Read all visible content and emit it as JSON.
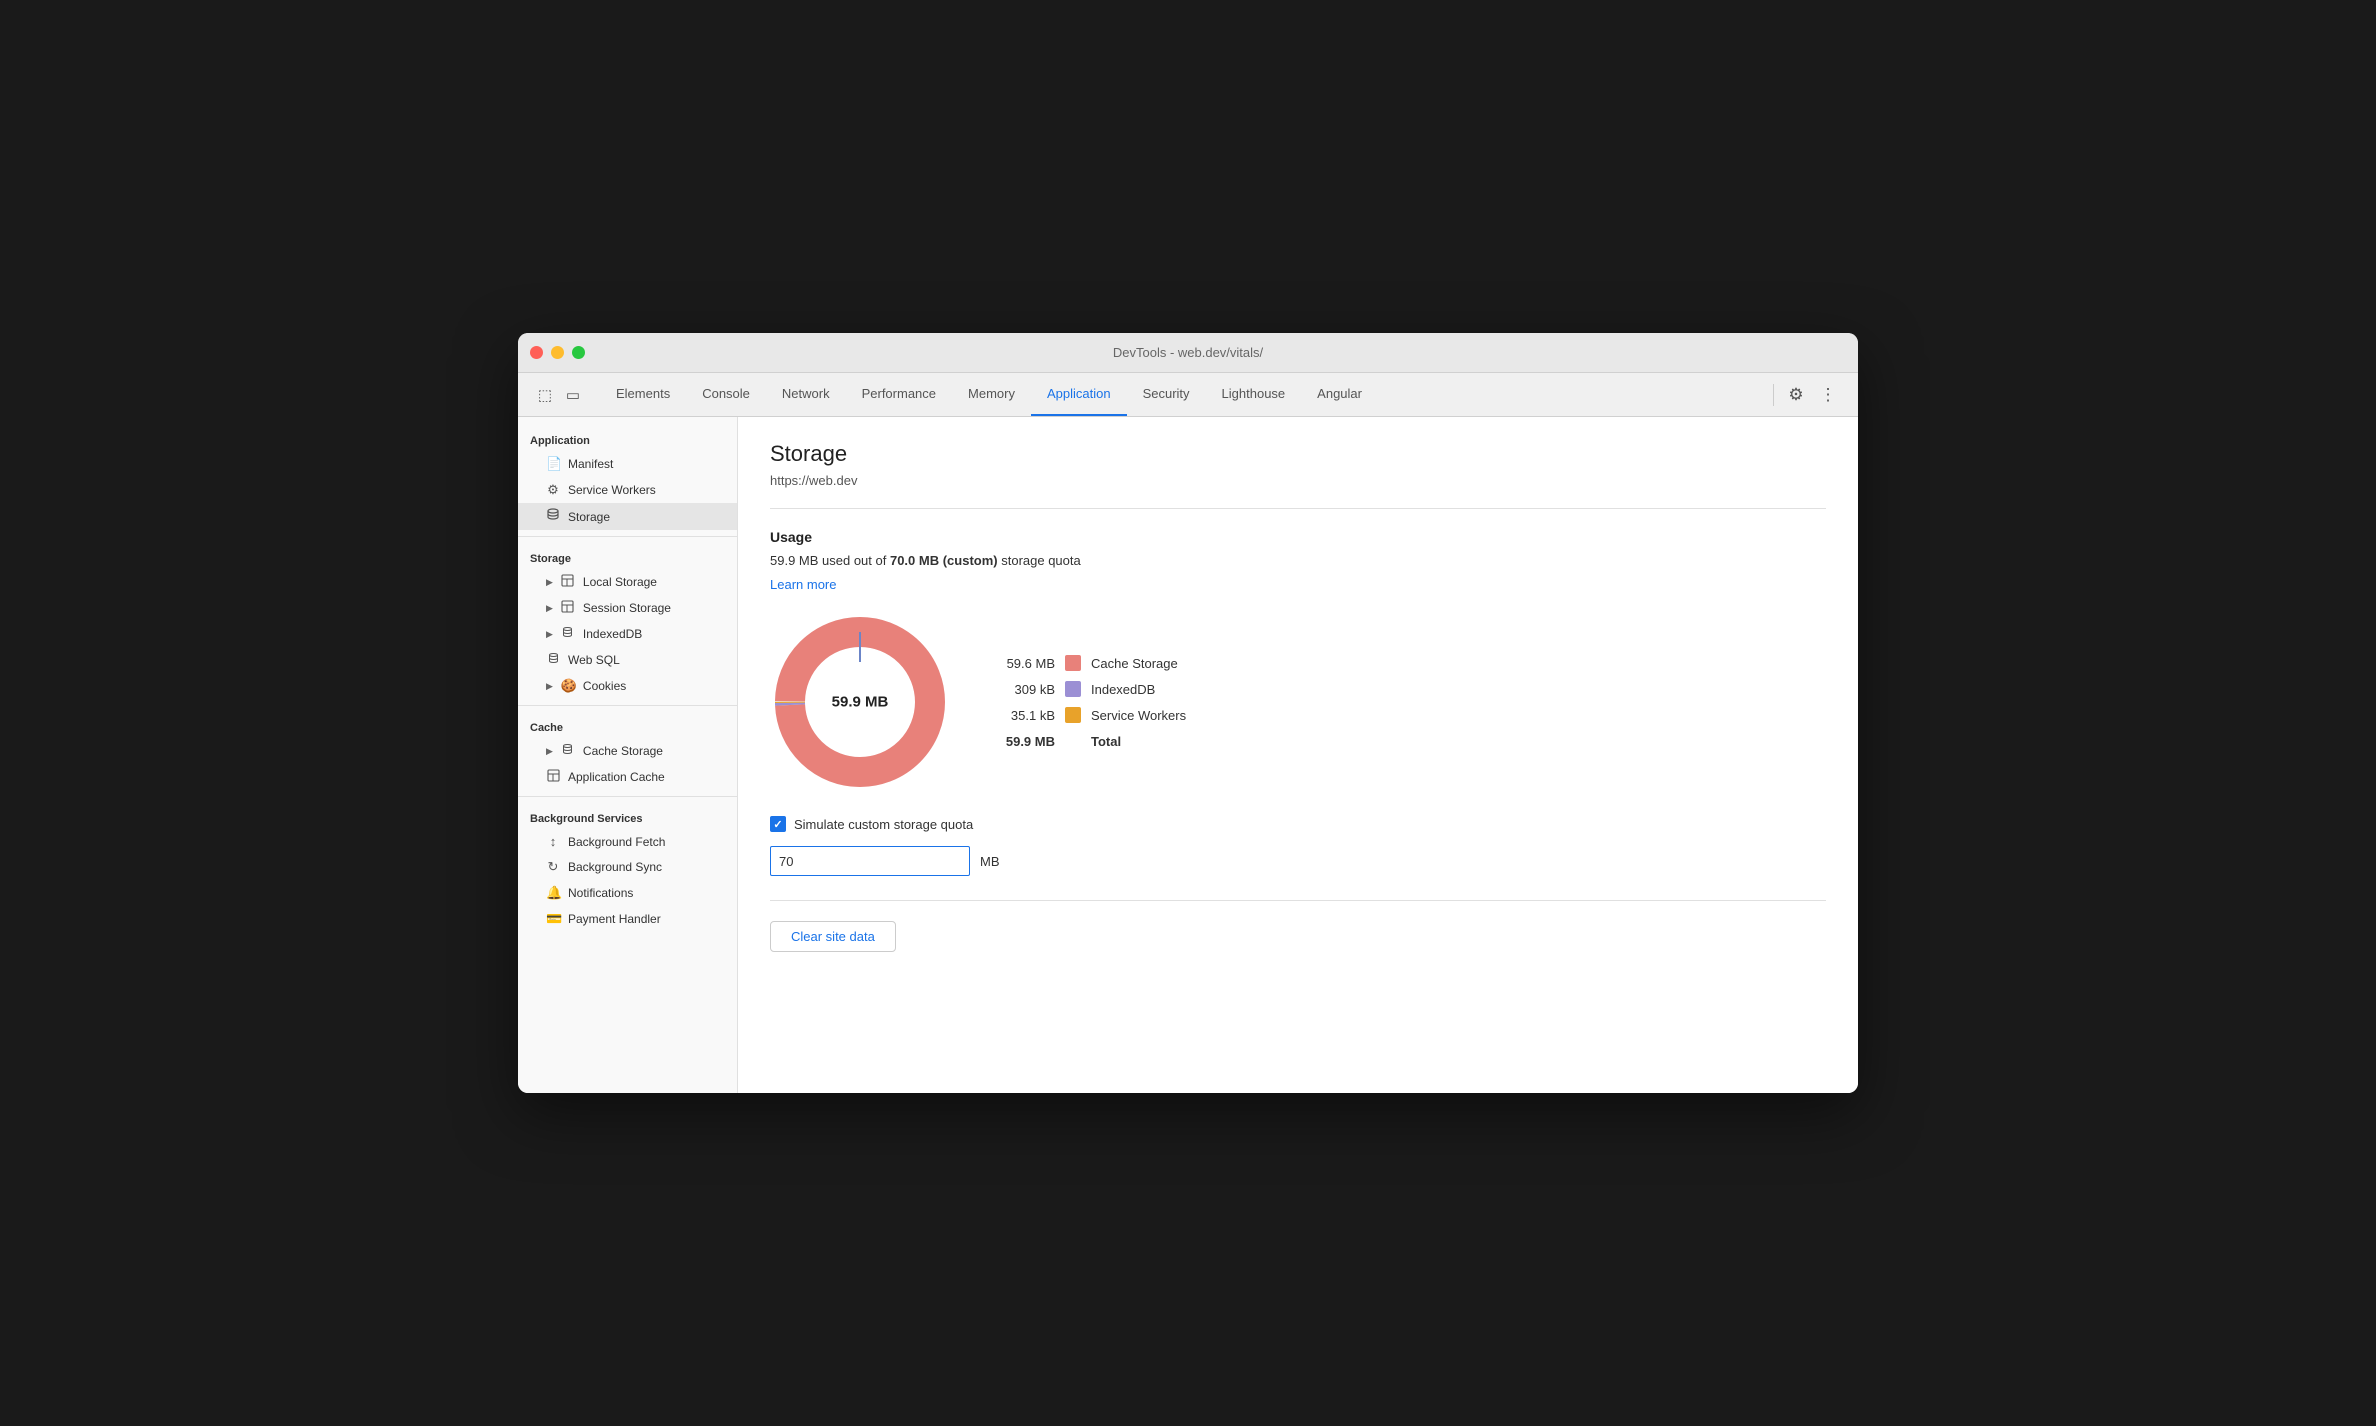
{
  "window": {
    "title": "DevTools - web.dev/vitals/"
  },
  "tabs": {
    "items": [
      {
        "label": "Elements",
        "active": false
      },
      {
        "label": "Console",
        "active": false
      },
      {
        "label": "Network",
        "active": false
      },
      {
        "label": "Performance",
        "active": false
      },
      {
        "label": "Memory",
        "active": false
      },
      {
        "label": "Application",
        "active": true
      },
      {
        "label": "Security",
        "active": false
      },
      {
        "label": "Lighthouse",
        "active": false
      },
      {
        "label": "Angular",
        "active": false
      }
    ]
  },
  "sidebar": {
    "sections": [
      {
        "label": "Application",
        "items": [
          {
            "label": "Manifest",
            "icon": "📄",
            "indented": "1"
          },
          {
            "label": "Service Workers",
            "icon": "⚙️",
            "indented": "1"
          },
          {
            "label": "Storage",
            "icon": "🗄",
            "indented": "1",
            "active": true
          }
        ]
      },
      {
        "label": "Storage",
        "items": [
          {
            "label": "Local Storage",
            "icon": "▦",
            "indented": "1",
            "arrow": true
          },
          {
            "label": "Session Storage",
            "icon": "▦",
            "indented": "1",
            "arrow": true
          },
          {
            "label": "IndexedDB",
            "icon": "🗄",
            "indented": "1",
            "arrow": true
          },
          {
            "label": "Web SQL",
            "icon": "🗄",
            "indented": "1"
          },
          {
            "label": "Cookies",
            "icon": "🍪",
            "indented": "1",
            "arrow": true
          }
        ]
      },
      {
        "label": "Cache",
        "items": [
          {
            "label": "Cache Storage",
            "icon": "🗄",
            "indented": "1",
            "arrow": true
          },
          {
            "label": "Application Cache",
            "icon": "▦",
            "indented": "1"
          }
        ]
      },
      {
        "label": "Background Services",
        "items": [
          {
            "label": "Background Fetch",
            "icon": "↕",
            "indented": "1"
          },
          {
            "label": "Background Sync",
            "icon": "↻",
            "indented": "1"
          },
          {
            "label": "Notifications",
            "icon": "🔔",
            "indented": "1"
          },
          {
            "label": "Payment Handler",
            "icon": "💳",
            "indented": "1"
          }
        ]
      }
    ]
  },
  "panel": {
    "title": "Storage",
    "url": "https://web.dev",
    "usage": {
      "heading": "Usage",
      "description_prefix": "59.9 MB used out of ",
      "quota_bold": "70.0 MB (custom)",
      "description_suffix": " storage quota",
      "learn_more": "Learn more"
    },
    "chart": {
      "center_label": "59.9 MB",
      "total_used": 59.9,
      "segments": [
        {
          "label": "Cache Storage",
          "value": "59.6 MB",
          "color": "#e8817a",
          "percent": 99.5
        },
        {
          "label": "IndexedDB",
          "value": "309 kB",
          "color": "#9b8fd4",
          "percent": 0.5
        },
        {
          "label": "Service Workers",
          "value": "35.1 kB",
          "color": "#e8a22a",
          "percent": 0.1
        }
      ],
      "total_row": {
        "value": "59.9 MB",
        "label": "Total"
      }
    },
    "quota": {
      "checkbox_label": "Simulate custom storage quota",
      "input_value": "70",
      "unit": "MB"
    },
    "clear_button": "Clear site data"
  }
}
